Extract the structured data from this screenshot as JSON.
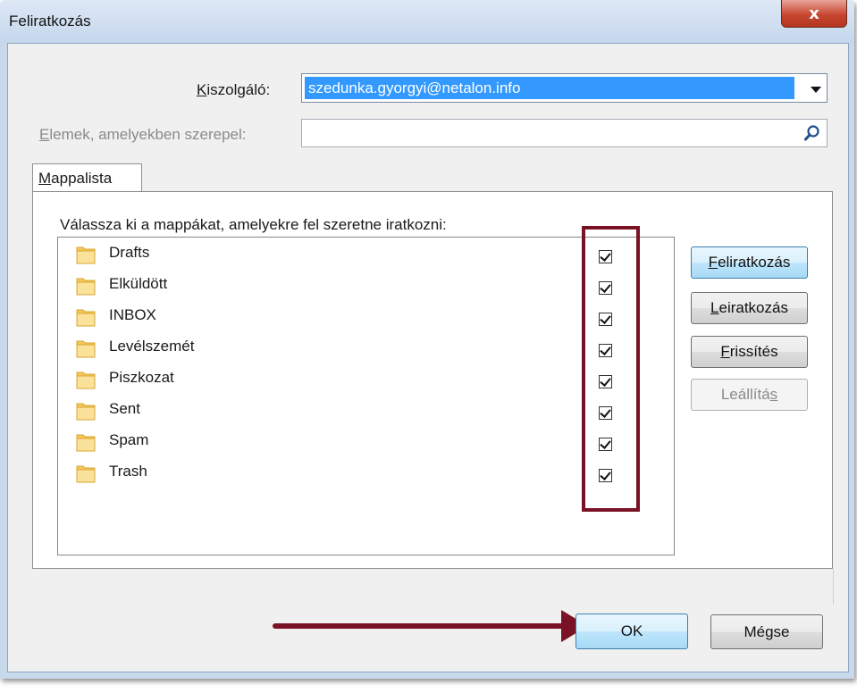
{
  "window": {
    "title": "Feliratkozás",
    "close_label": "x"
  },
  "server": {
    "label_mnemonic": "K",
    "label_rest": "iszolgáló:",
    "value": "szedunka.gyorgyi@netalon.info"
  },
  "filter": {
    "label_mnemonic": "E",
    "label_rest": "lemek, amelyekben szerepel:",
    "value": ""
  },
  "tab": {
    "label_mnemonic": "M",
    "label_rest": "appalista"
  },
  "instruction": "Válassza ki a mappákat, amelyekre fel szeretne iratkozni:",
  "folders": [
    {
      "name": "Drafts",
      "subscribed": true
    },
    {
      "name": "Elküldött",
      "subscribed": true
    },
    {
      "name": "INBOX",
      "subscribed": true
    },
    {
      "name": "Levélszemét",
      "subscribed": true
    },
    {
      "name": "Piszkozat",
      "subscribed": true
    },
    {
      "name": "Sent",
      "subscribed": true
    },
    {
      "name": "Spam",
      "subscribed": true
    },
    {
      "name": "Trash",
      "subscribed": true
    }
  ],
  "buttons": {
    "subscribe": {
      "mnemonic": "F",
      "rest": "eliratkozás"
    },
    "unsubscribe": {
      "mnemonic": "L",
      "rest": "eiratkozás"
    },
    "refresh": {
      "mnemonic": "F",
      "rest": "rissítés"
    },
    "stop": {
      "before": "Leállítá",
      "mnemonic": "s"
    },
    "ok": "OK",
    "cancel": "Mégse"
  },
  "colors": {
    "selection": "#3399ff",
    "annotation": "#7a1226",
    "folder": "#f5c85a"
  },
  "icons": {
    "search": "search-icon",
    "folder": "folder-icon",
    "dropdown": "chevron-down-icon",
    "close": "close-icon"
  }
}
